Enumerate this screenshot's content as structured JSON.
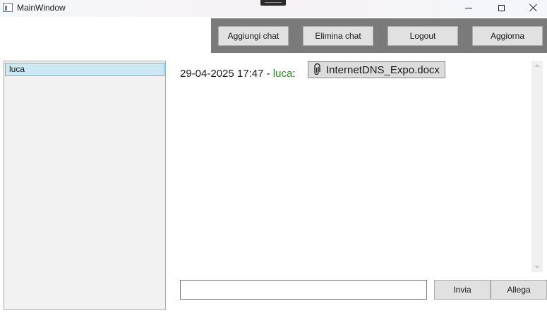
{
  "window": {
    "title": "MainWindow"
  },
  "toolbar": {
    "add_chat_label": "Aggiungi chat",
    "delete_chat_label": "Elimina chat",
    "logout_label": "Logout",
    "refresh_label": "Aggiorna"
  },
  "chat_list": {
    "items": [
      {
        "label": "luca",
        "selected": true
      }
    ]
  },
  "messages": [
    {
      "timestamp": "29-04-2025 17:47",
      "separator": " - ",
      "user": "luca",
      "colon": ":",
      "attachment": {
        "icon": "paperclip-icon",
        "filename": "InternetDNS_Expo.docx"
      }
    }
  ],
  "composer": {
    "value": "",
    "placeholder": "",
    "send_label": "Invia",
    "attach_label": "Allega"
  },
  "colors": {
    "toolbar_bg": "#7a7a7a",
    "user_name": "#2a8a2a",
    "selected_item_bg": "#cce8f4",
    "selected_item_border": "#70b0d8"
  }
}
